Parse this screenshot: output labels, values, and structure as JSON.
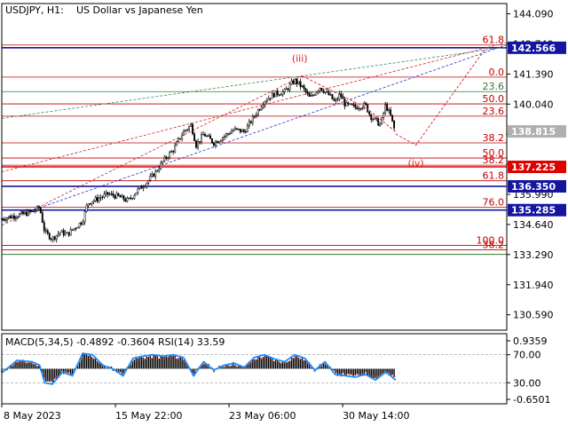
{
  "header": {
    "symbol": "USDJPY, H1:",
    "description": "US Dollar vs Japanese Yen"
  },
  "colors": {
    "candle": "#000000",
    "fib_red": "#c00000",
    "fib_green": "#2e7d32",
    "level_red": "#e00000",
    "level_blue": "#1010a0",
    "level_navy": "#20208a",
    "wave_label": "#e02020",
    "macd_hist": "#000000",
    "macd_signal": "#ff3030",
    "rsi_line": "#1e90ff",
    "trend_blue": "#2a2ad0",
    "trend_green": "#2e8b57",
    "trend_red": "#d02020",
    "price_box_gray": "#b0b0b0",
    "price_box_red": "#e00000",
    "price_box_blue": "#1515a0"
  },
  "chart_data": [
    {
      "type": "candlestick",
      "title": "USDJPY, H1:  US Dollar vs Japanese Yen",
      "ylim": [
        129.9,
        144.55
      ],
      "x_ticks": [
        "8 May 2023",
        "15 May 22:00",
        "23 May 06:00",
        "30 May 14:00"
      ],
      "y_ticks": [
        130.59,
        131.94,
        133.29,
        134.64,
        135.99,
        137.34,
        138.69,
        140.04,
        141.39,
        142.74,
        144.09
      ],
      "price_close_path": [
        {
          "x": 0.0,
          "price": 134.9
        },
        {
          "x": 3.0,
          "price": 135.05
        },
        {
          "x": 6.0,
          "price": 135.2
        },
        {
          "x": 7.5,
          "price": 135.4
        },
        {
          "x": 8.5,
          "price": 134.3
        },
        {
          "x": 10.0,
          "price": 134.0
        },
        {
          "x": 11.5,
          "price": 134.3
        },
        {
          "x": 13.0,
          "price": 134.2
        },
        {
          "x": 16.0,
          "price": 134.8
        },
        {
          "x": 17.0,
          "price": 135.6
        },
        {
          "x": 19.0,
          "price": 135.8
        },
        {
          "x": 21.0,
          "price": 136.0
        },
        {
          "x": 23.0,
          "price": 135.9
        },
        {
          "x": 25.0,
          "price": 135.7
        },
        {
          "x": 27.0,
          "price": 136.2
        },
        {
          "x": 29.0,
          "price": 136.6
        },
        {
          "x": 30.5,
          "price": 137.0
        },
        {
          "x": 32.0,
          "price": 137.5
        },
        {
          "x": 34.0,
          "price": 138.0
        },
        {
          "x": 36.0,
          "price": 138.8
        },
        {
          "x": 37.5,
          "price": 139.1
        },
        {
          "x": 38.5,
          "price": 138.2
        },
        {
          "x": 40.0,
          "price": 138.7
        },
        {
          "x": 42.0,
          "price": 138.3
        },
        {
          "x": 44.0,
          "price": 138.6
        },
        {
          "x": 46.0,
          "price": 138.9
        },
        {
          "x": 48.0,
          "price": 138.8
        },
        {
          "x": 50.0,
          "price": 139.5
        },
        {
          "x": 52.0,
          "price": 140.2
        },
        {
          "x": 54.0,
          "price": 140.5
        },
        {
          "x": 56.0,
          "price": 140.6
        },
        {
          "x": 58.0,
          "price": 141.1
        },
        {
          "x": 59.5,
          "price": 140.8
        },
        {
          "x": 61.0,
          "price": 140.3
        },
        {
          "x": 63.0,
          "price": 140.8
        },
        {
          "x": 65.0,
          "price": 140.4
        },
        {
          "x": 66.0,
          "price": 140.1
        },
        {
          "x": 67.0,
          "price": 140.5
        },
        {
          "x": 68.0,
          "price": 140.0
        },
        {
          "x": 70.0,
          "price": 139.9
        },
        {
          "x": 72.0,
          "price": 140.0
        },
        {
          "x": 73.0,
          "price": 139.5
        },
        {
          "x": 74.0,
          "price": 139.3
        },
        {
          "x": 75.0,
          "price": 139.1
        },
        {
          "x": 76.0,
          "price": 140.0
        },
        {
          "x": 77.0,
          "price": 139.5
        },
        {
          "x": 78.0,
          "price": 138.7
        }
      ],
      "fib_levels": [
        {
          "label": "61.8",
          "price": 142.69,
          "color": "fib_red"
        },
        {
          "label": "0.0",
          "price": 141.25,
          "color": "fib_red"
        },
        {
          "label": "23.6",
          "price": 140.6,
          "color": "fib_green"
        },
        {
          "label": "50.0",
          "price": 140.05,
          "color": "fib_red"
        },
        {
          "label": "23.6",
          "price": 139.5,
          "color": "fib_red"
        },
        {
          "label": "38.2",
          "price": 138.3,
          "color": "fib_red"
        },
        {
          "label": "50.0",
          "price": 137.62,
          "color": "fib_red"
        },
        {
          "label": "38.2",
          "price": 137.3,
          "color": "fib_red"
        },
        {
          "label": "61.8",
          "price": 136.6,
          "color": "fib_red"
        },
        {
          "label": "76.0",
          "price": 135.42,
          "color": "fib_red"
        },
        {
          "label": "100.0",
          "price": 133.7,
          "color": "fib_red"
        },
        {
          "label": "38.2",
          "price": 133.5,
          "color": "fib_red"
        }
      ],
      "price_levels": [
        {
          "label": "142.566",
          "price": 142.566,
          "box": "price_box_blue"
        },
        {
          "label": "138.815",
          "price": 138.815,
          "box": "price_box_gray"
        },
        {
          "label": "137.225",
          "price": 137.225,
          "box": "price_box_red"
        },
        {
          "label": "136.350",
          "price": 136.35,
          "box": "price_box_blue"
        },
        {
          "label": "135.285",
          "price": 135.285,
          "box": "price_box_blue"
        }
      ],
      "wave_labels": [
        {
          "text": "(iii)",
          "x": 59.0,
          "price": 141.95
        },
        {
          "text": "(iv)",
          "x": 82.0,
          "price": 137.25
        }
      ],
      "forecast_path": [
        {
          "x": 78.0,
          "price": 138.7
        },
        {
          "x": 82.0,
          "price": 138.2
        },
        {
          "x": 96.0,
          "price": 142.6
        }
      ],
      "wave_path": [
        {
          "x": 59.5,
          "price": 141.3
        },
        {
          "x": 72.0,
          "price": 139.9
        },
        {
          "x": 78.0,
          "price": 138.8
        }
      ]
    },
    {
      "type": "line",
      "title": "MACD(5,34,5) -0.4892 -0.3604 RSI(14) 33.59",
      "series": [
        {
          "name": "MACD(5,34,5)",
          "values": [
            -0.4892,
            -0.3604
          ]
        },
        {
          "name": "RSI(14)",
          "values": [
            33.59
          ]
        }
      ],
      "y_ticks": [
        "0.9359",
        "70.00",
        "30.00",
        "-0.6501"
      ],
      "ylim": [
        -0.6501,
        0.9359
      ],
      "rsi_levels": [
        70.0,
        30.0
      ],
      "rsi_path": [
        {
          "x": 0.0,
          "value": 44
        },
        {
          "x": 3.0,
          "value": 62
        },
        {
          "x": 6.0,
          "value": 60
        },
        {
          "x": 7.5,
          "value": 55
        },
        {
          "x": 8.5,
          "value": 30
        },
        {
          "x": 10.0,
          "value": 28
        },
        {
          "x": 12.0,
          "value": 45
        },
        {
          "x": 14.0,
          "value": 40
        },
        {
          "x": 16.0,
          "value": 72
        },
        {
          "x": 18.0,
          "value": 70
        },
        {
          "x": 20.0,
          "value": 55
        },
        {
          "x": 22.0,
          "value": 50
        },
        {
          "x": 24.0,
          "value": 40
        },
        {
          "x": 26.0,
          "value": 65
        },
        {
          "x": 28.0,
          "value": 68
        },
        {
          "x": 30.0,
          "value": 70
        },
        {
          "x": 32.0,
          "value": 68
        },
        {
          "x": 34.0,
          "value": 70
        },
        {
          "x": 36.0,
          "value": 66
        },
        {
          "x": 38.0,
          "value": 40
        },
        {
          "x": 40.0,
          "value": 60
        },
        {
          "x": 42.0,
          "value": 48
        },
        {
          "x": 44.0,
          "value": 55
        },
        {
          "x": 46.0,
          "value": 58
        },
        {
          "x": 48.0,
          "value": 52
        },
        {
          "x": 50.0,
          "value": 66
        },
        {
          "x": 52.0,
          "value": 70
        },
        {
          "x": 54.0,
          "value": 64
        },
        {
          "x": 56.0,
          "value": 60
        },
        {
          "x": 58.0,
          "value": 70
        },
        {
          "x": 60.0,
          "value": 65
        },
        {
          "x": 62.0,
          "value": 48
        },
        {
          "x": 64.0,
          "value": 60
        },
        {
          "x": 66.0,
          "value": 42
        },
        {
          "x": 68.0,
          "value": 40
        },
        {
          "x": 70.0,
          "value": 38
        },
        {
          "x": 72.0,
          "value": 42
        },
        {
          "x": 74.0,
          "value": 34
        },
        {
          "x": 76.0,
          "value": 45
        },
        {
          "x": 77.0,
          "value": 40
        },
        {
          "x": 78.0,
          "value": 33.59
        }
      ]
    }
  ]
}
